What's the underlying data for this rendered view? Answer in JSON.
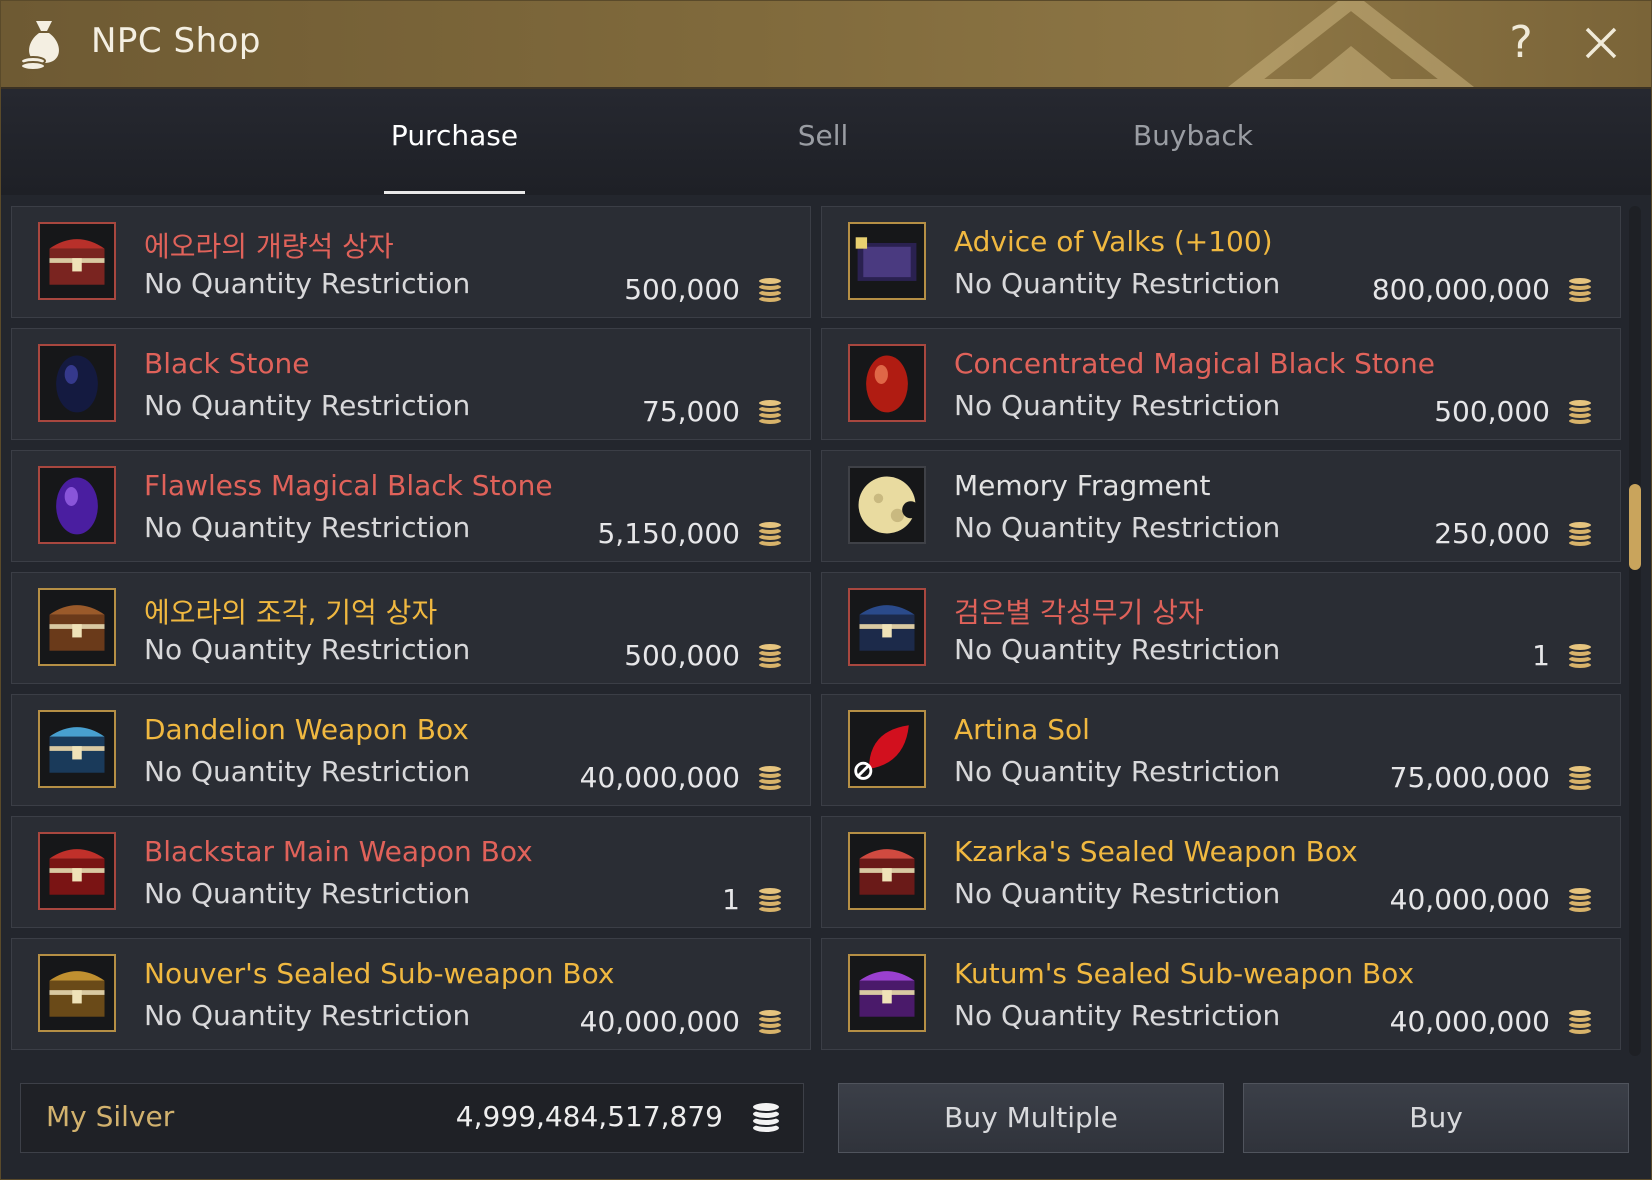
{
  "window": {
    "title": "NPC Shop",
    "help_label": "?"
  },
  "tabs": [
    {
      "label": "Purchase",
      "active": true
    },
    {
      "label": "Sell",
      "active": false
    },
    {
      "label": "Buyback",
      "active": false
    }
  ],
  "colors": {
    "name_red": "#e0625a",
    "name_gold": "#f0b840",
    "name_white": "#e2e2e2",
    "accent_gold": "#c9a45c"
  },
  "items": [
    {
      "name": "에오라의 개량석 상자",
      "restriction": "No Quantity Restriction",
      "price": "500,000",
      "color": "red",
      "icon": "eora-chest-icon"
    },
    {
      "name": "Advice of Valks (+100)",
      "restriction": "No Quantity Restriction",
      "price": "800,000,000",
      "color": "gold",
      "icon": "valks-scroll-icon"
    },
    {
      "name": "Black Stone",
      "restriction": "No Quantity Restriction",
      "price": "75,000",
      "color": "red",
      "icon": "black-stone-icon"
    },
    {
      "name": "Concentrated Magical Black Stone",
      "restriction": "No Quantity Restriction",
      "price": "500,000",
      "color": "red",
      "icon": "concentrated-black-stone-icon"
    },
    {
      "name": "Flawless Magical Black Stone",
      "restriction": "No Quantity Restriction",
      "price": "5,150,000",
      "color": "red",
      "icon": "flawless-black-stone-icon"
    },
    {
      "name": "Memory Fragment",
      "restriction": "No Quantity Restriction",
      "price": "250,000",
      "color": "white",
      "icon": "memory-fragment-icon"
    },
    {
      "name": "에오라의 조각, 기억 상자",
      "restriction": "No Quantity Restriction",
      "price": "500,000",
      "color": "gold",
      "icon": "eora-memory-chest-icon"
    },
    {
      "name": "검은별 각성무기 상자",
      "restriction": "No Quantity Restriction",
      "price": "1",
      "color": "red",
      "icon": "blackstar-awakening-box-icon"
    },
    {
      "name": "Dandelion Weapon Box",
      "restriction": "No Quantity Restriction",
      "price": "40,000,000",
      "color": "gold",
      "icon": "dandelion-box-icon"
    },
    {
      "name": "Artina Sol",
      "restriction": "No Quantity Restriction",
      "price": "75,000,000",
      "color": "gold",
      "icon": "artina-sol-icon"
    },
    {
      "name": "Blackstar Main Weapon Box",
      "restriction": "No Quantity Restriction",
      "price": "1",
      "color": "red",
      "icon": "blackstar-main-box-icon"
    },
    {
      "name": "Kzarka's Sealed Weapon Box",
      "restriction": "No Quantity Restriction",
      "price": "40,000,000",
      "color": "gold",
      "icon": "kzarka-box-icon"
    },
    {
      "name": "Nouver's Sealed Sub-weapon Box",
      "restriction": "No Quantity Restriction",
      "price": "40,000,000",
      "color": "gold",
      "icon": "nouver-box-icon"
    },
    {
      "name": "Kutum's Sealed Sub-weapon Box",
      "restriction": "No Quantity Restriction",
      "price": "40,000,000",
      "color": "gold",
      "icon": "kutum-box-icon"
    }
  ],
  "footer": {
    "silver_label": "My Silver",
    "silver_value": "4,999,484,517,879",
    "buy_multiple_label": "Buy Multiple",
    "buy_label": "Buy"
  }
}
